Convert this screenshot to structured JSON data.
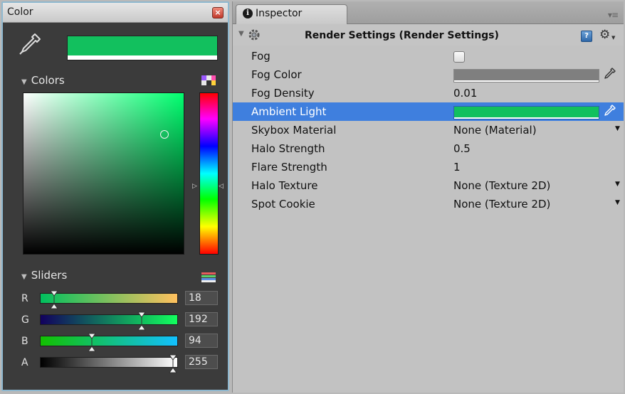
{
  "color_window": {
    "title": "Color",
    "close_icon": "close-icon",
    "current_color": "#12c05e",
    "colors_section": "Colors",
    "sliders_section": "Sliders",
    "sliders": [
      {
        "label": "R",
        "value": "18"
      },
      {
        "label": "G",
        "value": "192"
      },
      {
        "label": "B",
        "value": "94"
      },
      {
        "label": "A",
        "value": "255"
      }
    ]
  },
  "inspector": {
    "tab_label": "Inspector",
    "tab_icon_glyph": "i",
    "component_title": "Render Settings (Render Settings)",
    "help_glyph": "?",
    "properties": [
      {
        "label": "Fog",
        "kind": "checkbox",
        "checked": false
      },
      {
        "label": "Fog Color",
        "kind": "color",
        "color": "#7f7f7f"
      },
      {
        "label": "Fog Density",
        "kind": "text",
        "value": "0.01"
      },
      {
        "label": "Ambient Light",
        "kind": "color",
        "color": "#12c05e",
        "selected": true
      },
      {
        "label": "Skybox Material",
        "kind": "dropdown",
        "value": "None (Material)"
      },
      {
        "label": "Halo Strength",
        "kind": "text",
        "value": "0.5"
      },
      {
        "label": "Flare Strength",
        "kind": "text",
        "value": "1"
      },
      {
        "label": "Halo Texture",
        "kind": "dropdown",
        "value": "None (Texture 2D)"
      },
      {
        "label": "Spot Cookie",
        "kind": "dropdown",
        "value": "None (Texture 2D)"
      }
    ]
  },
  "colors": {
    "selection": "#3f7fde",
    "panel_dark": "#3b3b3b",
    "inspector_bg": "#c2c2c2"
  }
}
